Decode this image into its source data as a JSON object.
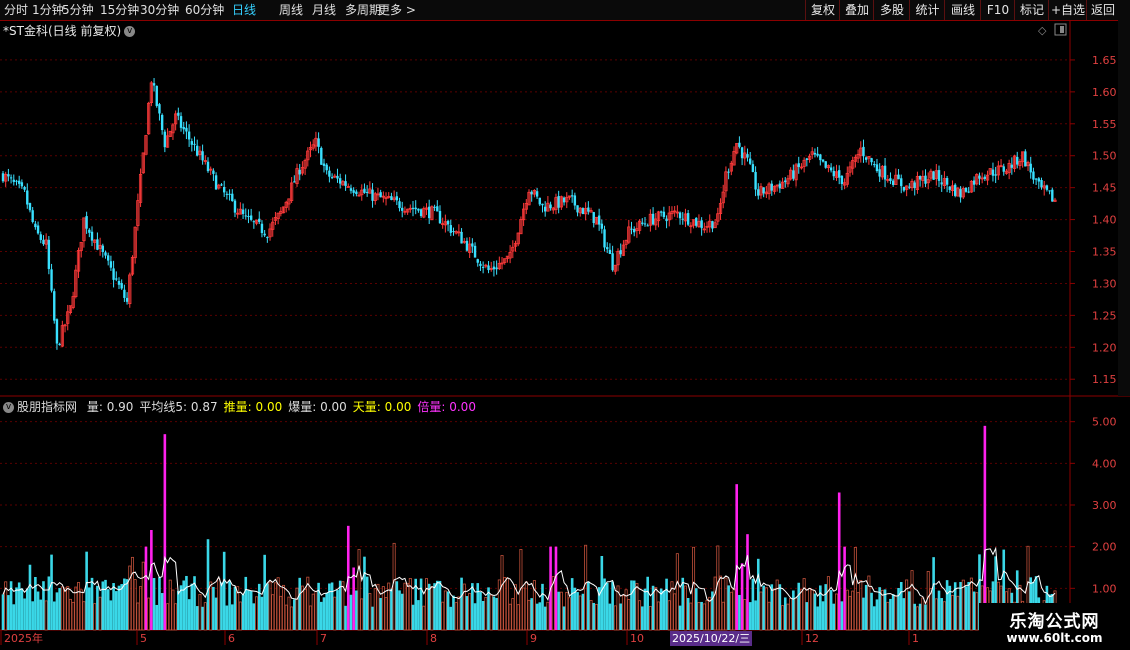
{
  "toolbar": {
    "periods": [
      "分时",
      "1分钟",
      "5分钟",
      "15分钟",
      "30分钟",
      "60分钟",
      "日线",
      "周线",
      "月线",
      "多周期",
      "更多"
    ],
    "active_period": "日线",
    "right_buttons": [
      "复权",
      "叠加",
      "多股",
      "统计",
      "画线",
      "F10",
      "标记",
      "+自选",
      "返回"
    ]
  },
  "stock": {
    "name": "*ST金科",
    "mode": "(日线 前复权)"
  },
  "indicator": {
    "name": "股朋指标网",
    "items": [
      {
        "label": "量:",
        "value": "0.90",
        "color": "#dddddd"
      },
      {
        "label": "平均线5:",
        "value": "0.87",
        "color": "#dddddd"
      },
      {
        "label": "推量:",
        "value": "0.00",
        "color": "#ffff00"
      },
      {
        "label": "爆量:",
        "value": "0.00",
        "color": "#dddddd"
      },
      {
        "label": "天量:",
        "value": "0.00",
        "color": "#ffff00"
      },
      {
        "label": "倍量:",
        "value": "0.00",
        "color": "#ff33ff"
      }
    ]
  },
  "chart_data": [
    {
      "type": "candlestick",
      "ylim": [
        1.13,
        1.7
      ],
      "y_ticks": [
        "1.65",
        "1.60",
        "1.55",
        "1.50",
        "1.45",
        "1.40",
        "1.35",
        "1.30",
        "1.25",
        "1.20",
        "1.15"
      ],
      "anchors": [
        [
          0,
          1.47
        ],
        [
          8,
          1.44
        ],
        [
          12,
          1.38
        ],
        [
          16,
          1.36
        ],
        [
          20,
          1.2
        ],
        [
          25,
          1.26
        ],
        [
          30,
          1.4
        ],
        [
          35,
          1.36
        ],
        [
          40,
          1.32
        ],
        [
          46,
          1.27
        ],
        [
          52,
          1.5
        ],
        [
          55,
          1.62
        ],
        [
          60,
          1.52
        ],
        [
          64,
          1.56
        ],
        [
          70,
          1.52
        ],
        [
          80,
          1.45
        ],
        [
          90,
          1.4
        ],
        [
          98,
          1.38
        ],
        [
          103,
          1.41
        ],
        [
          110,
          1.48
        ],
        [
          116,
          1.52
        ],
        [
          120,
          1.47
        ],
        [
          135,
          1.44
        ],
        [
          150,
          1.42
        ],
        [
          160,
          1.41
        ],
        [
          170,
          1.37
        ],
        [
          180,
          1.32
        ],
        [
          188,
          1.34
        ],
        [
          195,
          1.45
        ],
        [
          200,
          1.42
        ],
        [
          210,
          1.43
        ],
        [
          220,
          1.4
        ],
        [
          226,
          1.33
        ],
        [
          232,
          1.38
        ],
        [
          240,
          1.4
        ],
        [
          250,
          1.41
        ],
        [
          260,
          1.39
        ],
        [
          265,
          1.4
        ],
        [
          268,
          1.47
        ],
        [
          272,
          1.52
        ],
        [
          276,
          1.49
        ],
        [
          280,
          1.44
        ],
        [
          290,
          1.46
        ],
        [
          300,
          1.5
        ],
        [
          305,
          1.48
        ],
        [
          312,
          1.46
        ],
        [
          318,
          1.51
        ],
        [
          324,
          1.48
        ],
        [
          335,
          1.45
        ],
        [
          345,
          1.47
        ],
        [
          355,
          1.44
        ],
        [
          362,
          1.47
        ],
        [
          372,
          1.48
        ],
        [
          378,
          1.5
        ],
        [
          384,
          1.45
        ],
        [
          390,
          1.43
        ]
      ],
      "colors": {
        "up": "#ff3a3a",
        "down": "#39e0ff"
      }
    },
    {
      "type": "bar",
      "ylim": [
        0,
        5.4
      ],
      "y_ticks": [
        "5.00",
        "4.00",
        "3.00",
        "2.00",
        "1.00"
      ],
      "x_tick_labels": [
        "2025年",
        "5",
        "6",
        "7",
        "8",
        "9",
        "10",
        "2025/10/22/三",
        "12",
        "1"
      ],
      "spikes": [
        [
          53,
          2.0
        ],
        [
          55,
          2.4
        ],
        [
          60,
          4.7
        ],
        [
          128,
          2.5
        ],
        [
          130,
          1.5
        ],
        [
          203,
          2.0
        ],
        [
          205,
          2.0
        ],
        [
          272,
          3.5
        ],
        [
          274,
          1.6
        ],
        [
          276,
          2.3
        ],
        [
          310,
          3.3
        ],
        [
          312,
          2.0
        ],
        [
          364,
          4.9
        ]
      ],
      "colors": {
        "up": "#c0503a",
        "down": "#3ad8e8",
        "spike": "#ff22ee",
        "ma": "#ffffff"
      }
    }
  ],
  "watermark": {
    "line1": "乐淘公式网",
    "line2": "www.60lt.com"
  }
}
